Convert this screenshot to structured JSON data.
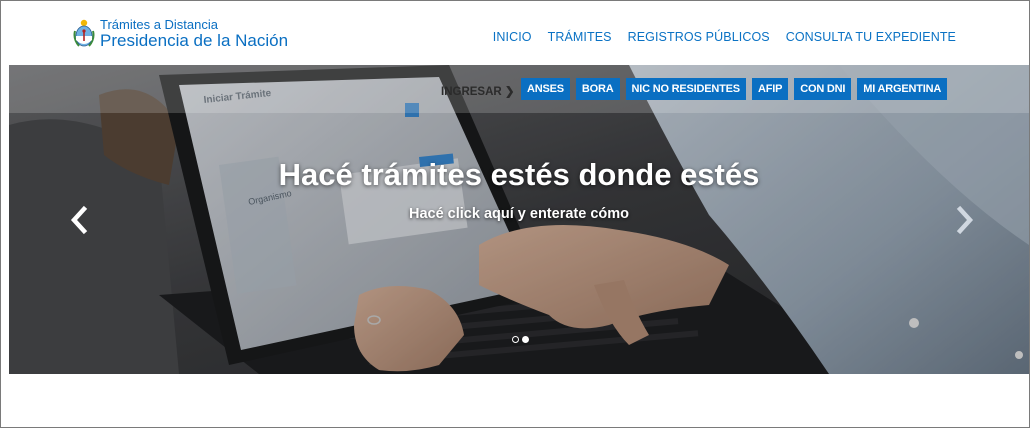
{
  "brand": {
    "line1": "Trámites a Distancia",
    "line2": "Presidencia de la Nación"
  },
  "nav": {
    "items": [
      {
        "label": "INICIO"
      },
      {
        "label": "TRÁMITES"
      },
      {
        "label": "REGISTROS PÚBLICOS"
      },
      {
        "label": "CONSULTA TU EXPEDIENTE"
      }
    ]
  },
  "hero": {
    "login_label": "INGRESAR",
    "login_chevron": "❯",
    "quick_links": [
      {
        "label": "ANSES"
      },
      {
        "label": "BORA"
      },
      {
        "label": "NIC NO RESIDENTES"
      },
      {
        "label": "AFIP"
      },
      {
        "label": "CON DNI"
      },
      {
        "label": "MI ARGENTINA"
      }
    ],
    "title": "Hacé trámites estés donde estés",
    "subtitle": "Hacé click aquí y enterate cómo",
    "screen_heading": "Iniciar Trámite",
    "screen_sidebar_heading": "Organismo",
    "slides_total": 2,
    "slide_active": 2
  },
  "colors": {
    "accent": "#0a6fc2",
    "nav_text": "#0a72c4"
  },
  "icons": {
    "logo": "argentina-coat-of-arms-icon",
    "prev": "chevron-left-icon",
    "next": "chevron-right-icon"
  }
}
